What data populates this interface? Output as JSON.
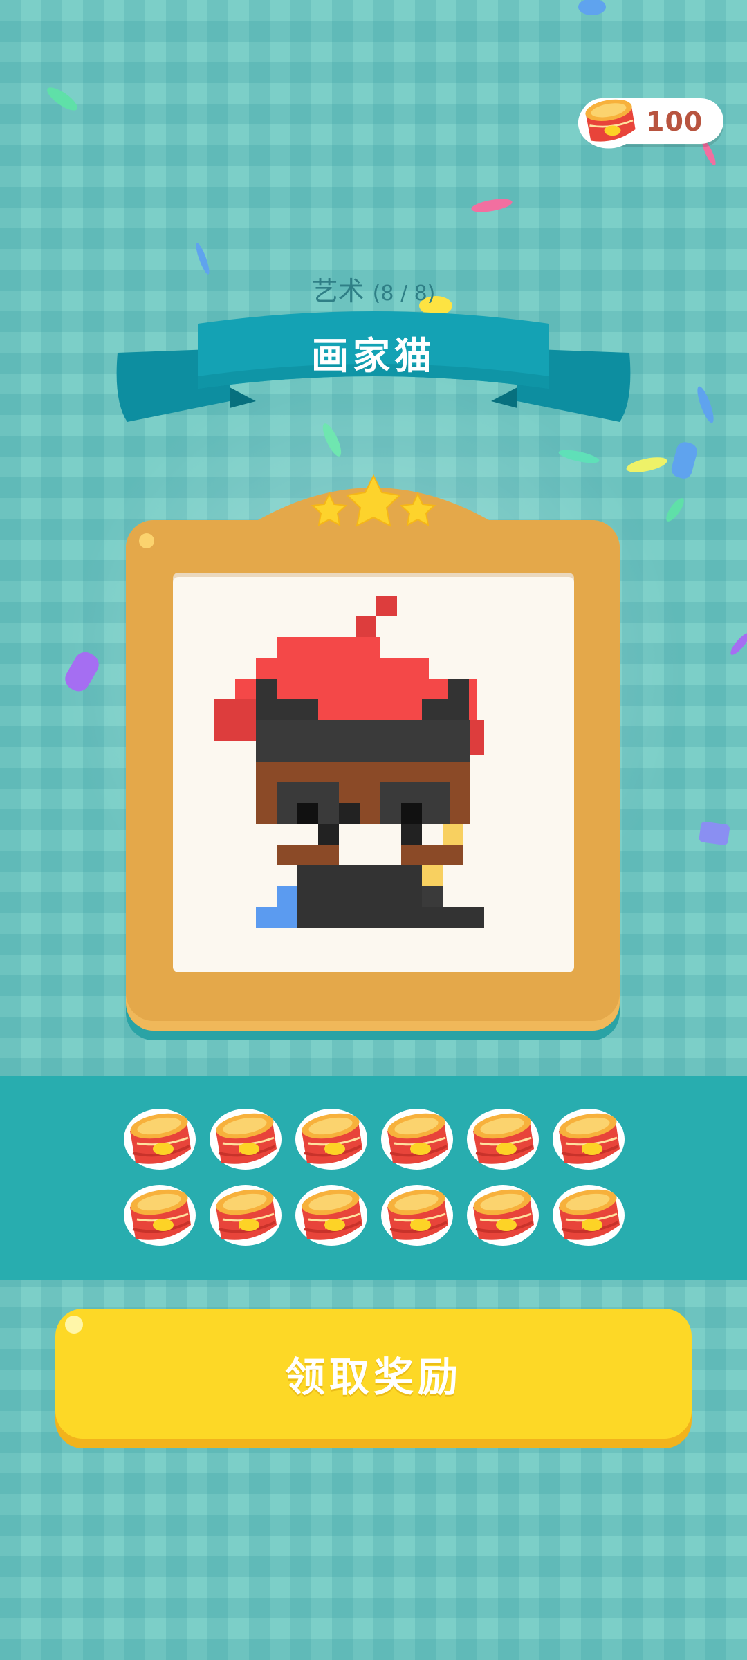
{
  "currency": {
    "amount": "100",
    "icon": "cat-food-can-icon"
  },
  "header": {
    "category": "艺术",
    "progress": "(8 / 8)",
    "title": "画家猫"
  },
  "artwork": {
    "rating_stars": 3,
    "subject": "cat-painter-pixel-art"
  },
  "rewards": {
    "item_icon": "cat-food-can-icon",
    "count": 12
  },
  "buttons": {
    "claim_label": "领取奖励"
  },
  "colors": {
    "background": "#7ccfc8",
    "ribbon": "#14a2b4",
    "frame": "#e4a84a",
    "button": "#fdd826",
    "star": "#fdd32c"
  }
}
